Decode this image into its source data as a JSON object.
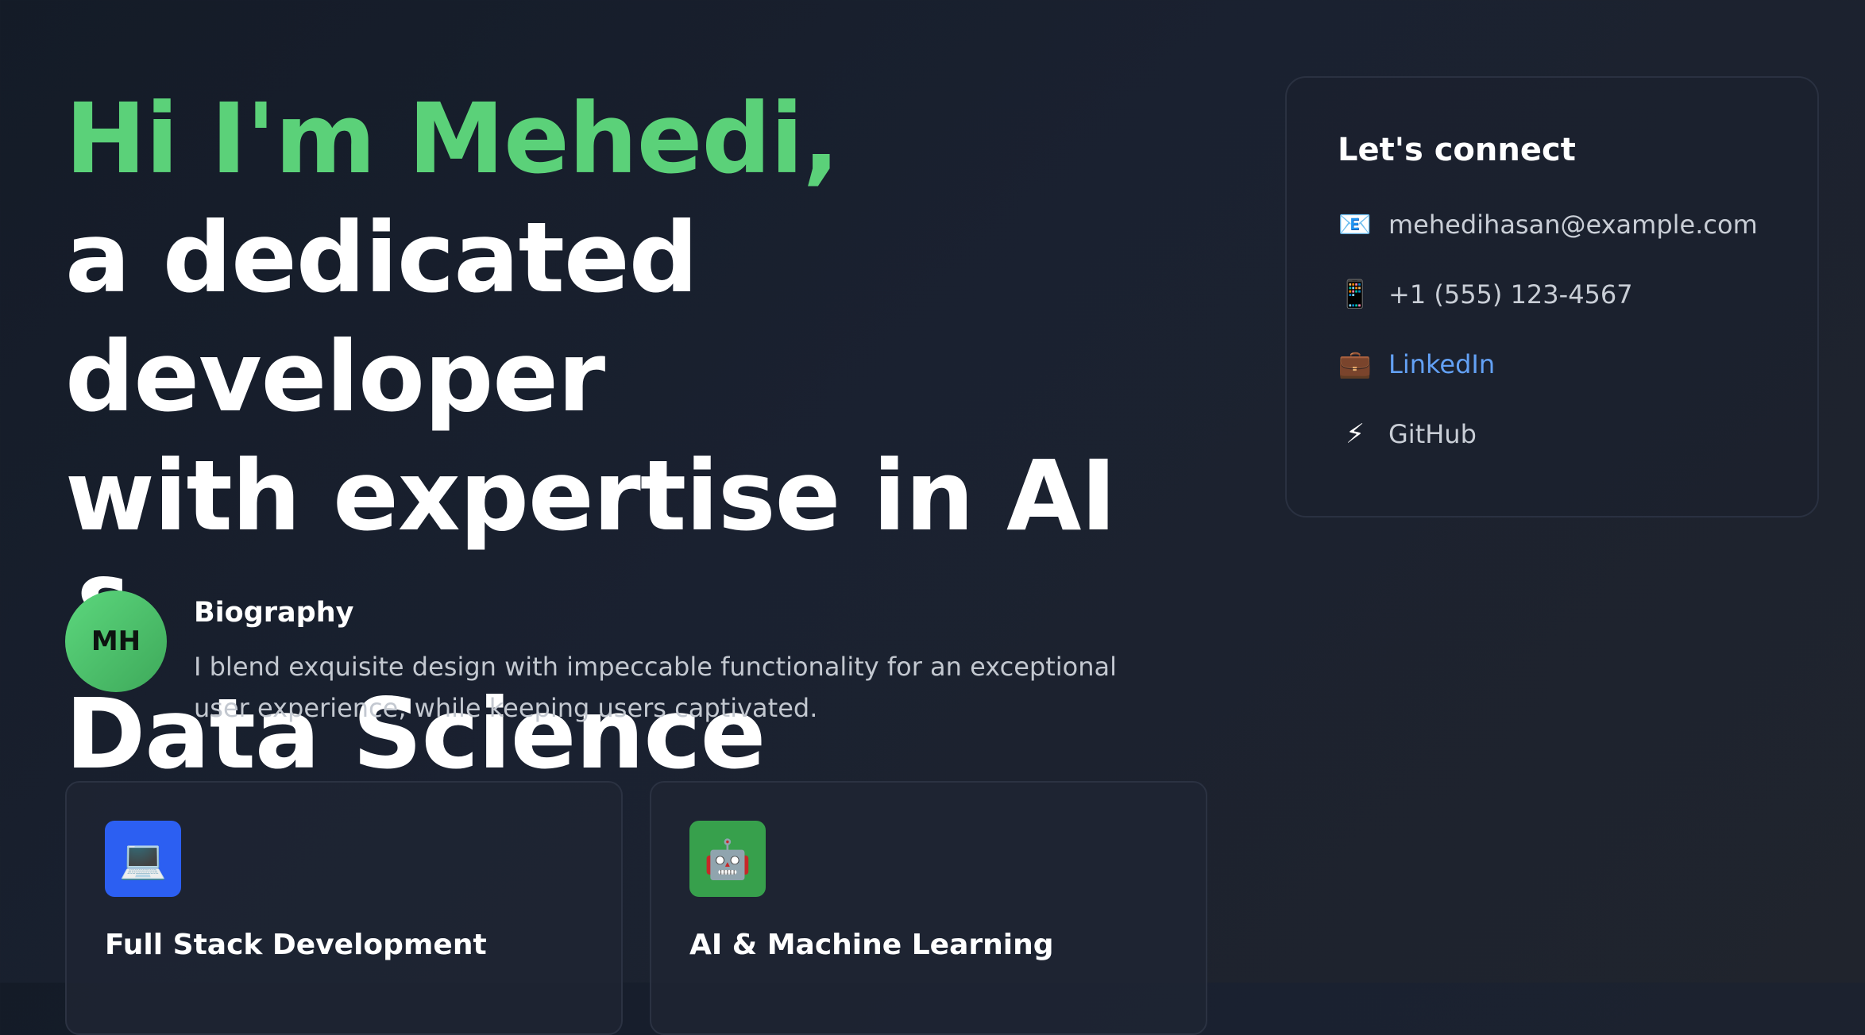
{
  "hero": {
    "greeting": "Hi I'm Mehedi,",
    "line1": "a dedicated developer",
    "line2": "with expertise in AI &",
    "line3": "Data Science"
  },
  "bio": {
    "avatar_initials": "MH",
    "title": "Biography",
    "body": "I blend exquisite design with impeccable functionality for an exceptional user experience, while keeping users captivated."
  },
  "cards": [
    {
      "icon": "💻",
      "icon_name": "laptop-icon",
      "title": "Full Stack Development",
      "color": "#2c5ff2"
    },
    {
      "icon": "🤖",
      "icon_name": "robot-icon",
      "title": "AI & Machine Learning",
      "color": "#37a04c"
    }
  ],
  "connect": {
    "title": "Let's connect",
    "items": [
      {
        "icon": "📧",
        "icon_name": "email-icon",
        "text": "mehedihasan@example.com"
      },
      {
        "icon": "📱",
        "icon_name": "phone-icon",
        "text": "+1 (555) 123-4567"
      },
      {
        "icon": "💼",
        "icon_name": "briefcase-icon",
        "text": "LinkedIn"
      },
      {
        "icon": "⚡",
        "icon_name": "lightning-icon",
        "text": "GitHub"
      }
    ]
  },
  "colors": {
    "accent_green": "#5bd179",
    "link_blue": "#63a1f5",
    "background": "#1a2130"
  }
}
